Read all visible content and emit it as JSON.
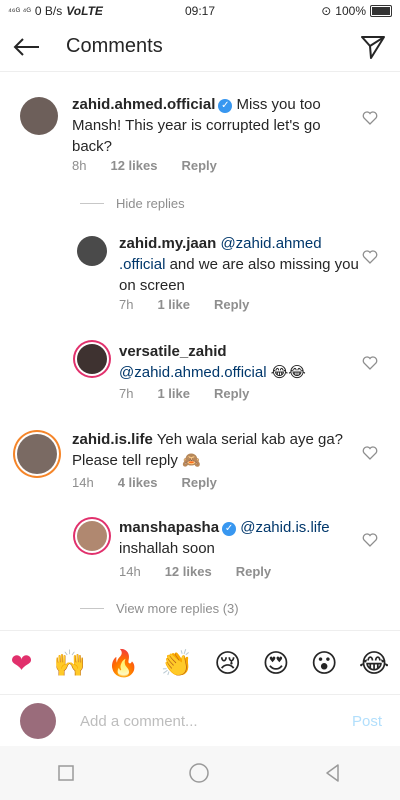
{
  "status": {
    "left": "⁴⁶ᴳ ⁴ᴳ",
    "speed": "0 B/s",
    "volte": "VoLTE",
    "time": "09:17",
    "battery": "100%"
  },
  "header": {
    "title": "Comments"
  },
  "comments": [
    {
      "user": "zahid.ahmed.official",
      "text": "Miss you too Mansh! This year is corrupted let's go back?",
      "time": "8h",
      "likes": "12 likes",
      "reply": "Reply"
    },
    {
      "user": "zahid.my.jaan",
      "mention": "@zahid.ahmed .official",
      "text": "and we are also missing you on screen",
      "time": "7h",
      "likes": "1 like",
      "reply": "Reply"
    },
    {
      "user": "versatile_zahid",
      "mention": "@zahid.ahmed.official",
      "emoji": "😂😂",
      "time": "7h",
      "likes": "1 like",
      "reply": "Reply"
    },
    {
      "user": "zahid.is.life",
      "text": "Yeh wala serial kab aye ga? Please tell reply 🙈",
      "time": "14h",
      "likes": "4 likes",
      "reply": "Reply"
    },
    {
      "user": "manshapasha",
      "mention": "@zahid.is.life",
      "text": "inshallah soon",
      "time": "14h",
      "likes": "12 likes",
      "reply": "Reply"
    }
  ],
  "hide_replies": "Hide replies",
  "view_more": "View more replies (3)",
  "emoji_bar": [
    "❤",
    "🙌",
    "🔥",
    "👏",
    "😢",
    "😍",
    "😮",
    "😂"
  ],
  "input": {
    "placeholder": "Add a comment..."
  },
  "post_label": "Post",
  "colors": {
    "link": "#00376b",
    "muted": "#8e8e8e",
    "verified": "#3897f0",
    "post": "#b2dffc"
  }
}
